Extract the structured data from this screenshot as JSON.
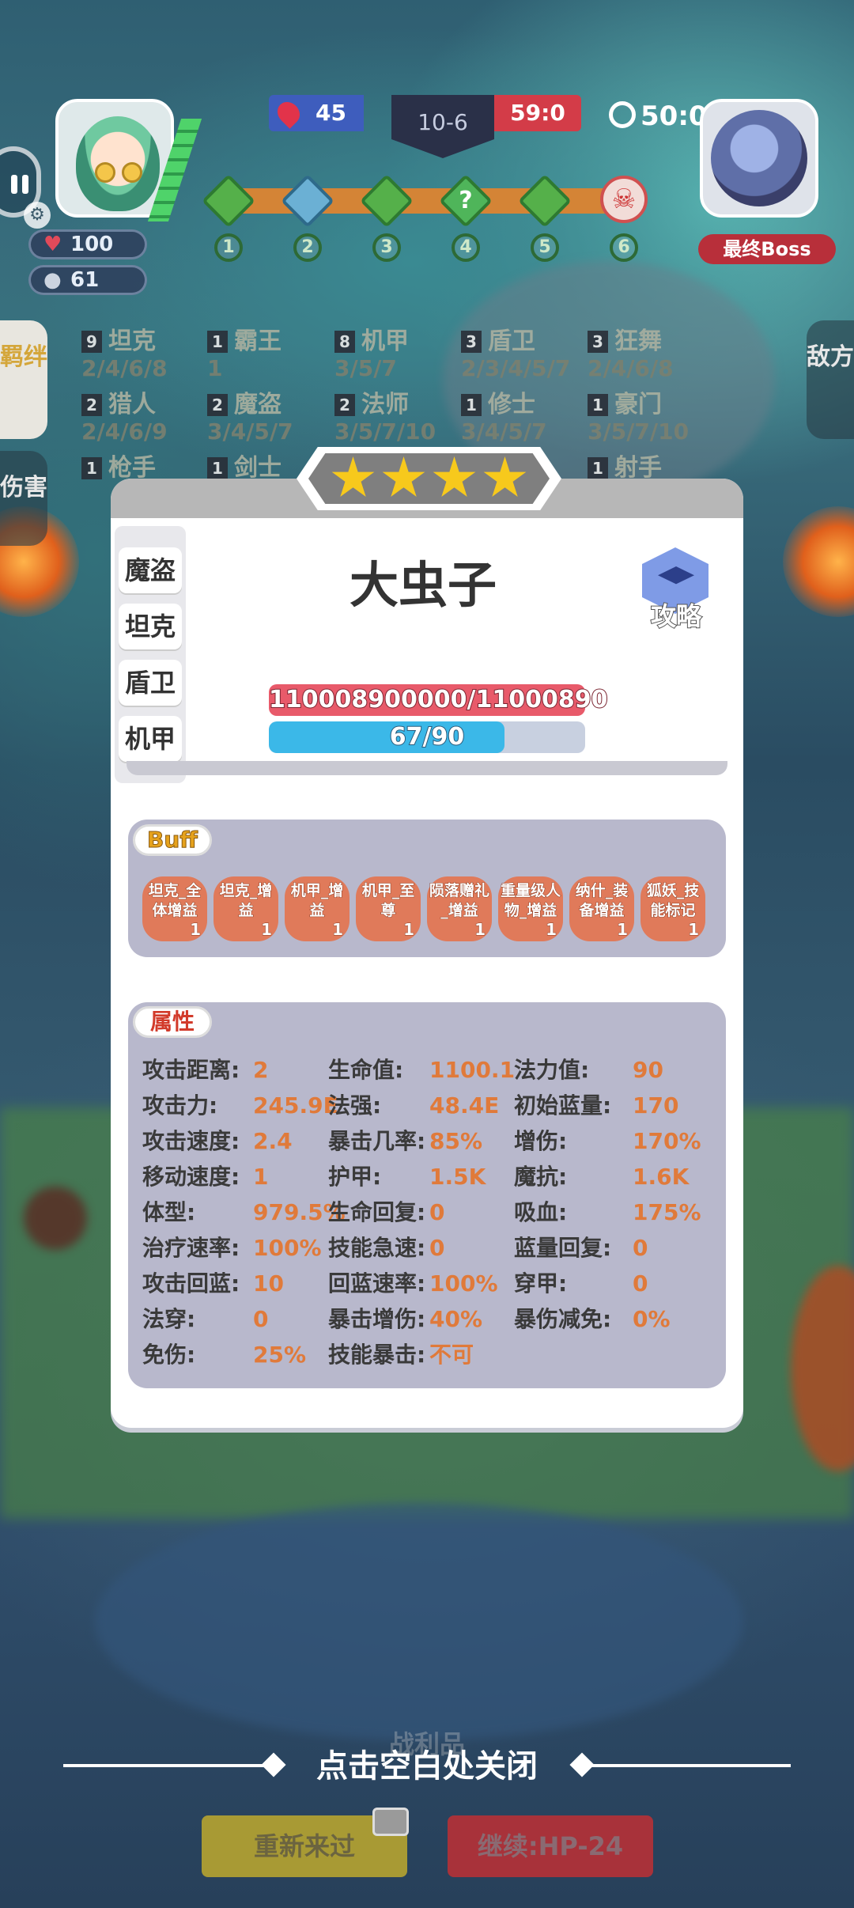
{
  "hud": {
    "player_hp": "100",
    "player_gold": "61",
    "score_left": "45",
    "stage": "10-6",
    "score_right": "59:0",
    "timer": "50:0",
    "boss_label": "最终Boss"
  },
  "stages": [
    "1",
    "2",
    "3",
    "4",
    "5",
    "6"
  ],
  "synergies": [
    {
      "count": "9",
      "name": "坦克",
      "levels": "2/4/6/8"
    },
    {
      "count": "1",
      "name": "霸王",
      "levels": "1"
    },
    {
      "count": "8",
      "name": "机甲",
      "levels": "3/5/7"
    },
    {
      "count": "3",
      "name": "盾卫",
      "levels": "2/3/4/5/7"
    },
    {
      "count": "3",
      "name": "狂舞",
      "levels": "2/4/6/8"
    },
    {
      "count": "2",
      "name": "猎人",
      "levels": "2/4/6/9"
    },
    {
      "count": "2",
      "name": "魔盗",
      "levels": "3/4/5/7"
    },
    {
      "count": "2",
      "name": "法师",
      "levels": "3/5/7/10"
    },
    {
      "count": "1",
      "name": "修士",
      "levels": "3/4/5/7"
    },
    {
      "count": "1",
      "name": "豪门",
      "levels": "3/5/7/10"
    },
    {
      "count": "1",
      "name": "枪手",
      "levels": ""
    },
    {
      "count": "1",
      "name": "剑士",
      "levels": ""
    },
    {
      "count": "1",
      "name": "射手",
      "levels": ""
    }
  ],
  "side_tabs": {
    "bond": "羁绊",
    "damage": "伤害",
    "enemy": "敌方"
  },
  "hero": {
    "stars": 4,
    "name": "大虫子",
    "guide_label": "攻略",
    "tags": [
      "魔盗",
      "坦克",
      "盾卫",
      "机甲"
    ],
    "hp_text": "110008900000/11000890",
    "mana_text": "67/90",
    "mana_fraction": 0.744
  },
  "buff_panel": {
    "title": "Buff",
    "buffs": [
      {
        "line1": "坦克_全",
        "line2": "体增益",
        "count": "1"
      },
      {
        "line1": "坦克_增",
        "line2": "益",
        "count": "1"
      },
      {
        "line1": "机甲_增",
        "line2": "益",
        "count": "1"
      },
      {
        "line1": "机甲_至",
        "line2": "尊",
        "count": "1"
      },
      {
        "line1": "陨落赠礼",
        "line2": "_增益",
        "count": "1"
      },
      {
        "line1": "重量级人",
        "line2": "物_增益",
        "count": "1"
      },
      {
        "line1": "纳什_装",
        "line2": "备增益",
        "count": "1"
      },
      {
        "line1": "狐妖_技",
        "line2": "能标记",
        "count": "1"
      }
    ]
  },
  "attr_panel": {
    "title": "属性",
    "rows": [
      [
        {
          "k": "攻击距离:",
          "v": "2"
        },
        {
          "k": "生命值:",
          "v": "1100.1"
        },
        {
          "k": "法力值:",
          "v": "90"
        }
      ],
      [
        {
          "k": "攻击力:",
          "v": "245.9E"
        },
        {
          "k": "法强:",
          "v": "48.4E"
        },
        {
          "k": "初始蓝量:",
          "v": "170"
        }
      ],
      [
        {
          "k": "攻击速度:",
          "v": "2.4"
        },
        {
          "k": "暴击几率:",
          "v": "85%"
        },
        {
          "k": "增伤:",
          "v": "170%"
        }
      ],
      [
        {
          "k": "移动速度:",
          "v": "1"
        },
        {
          "k": "护甲:",
          "v": "1.5K"
        },
        {
          "k": "魔抗:",
          "v": "1.6K"
        }
      ],
      [
        {
          "k": "体型:",
          "v": "979.5%"
        },
        {
          "k": "生命回复:",
          "v": "0"
        },
        {
          "k": "吸血:",
          "v": "175%"
        }
      ],
      [
        {
          "k": "治疗速率:",
          "v": "100%"
        },
        {
          "k": "技能急速:",
          "v": "0"
        },
        {
          "k": "蓝量回复:",
          "v": "0"
        }
      ],
      [
        {
          "k": "攻击回蓝:",
          "v": "10"
        },
        {
          "k": "回蓝速率:",
          "v": "100%"
        },
        {
          "k": "穿甲:",
          "v": "0"
        }
      ],
      [
        {
          "k": "法穿:",
          "v": "0"
        },
        {
          "k": "暴击增伤:",
          "v": "40%"
        },
        {
          "k": "暴伤减免:",
          "v": "0%"
        }
      ],
      [
        {
          "k": "免伤:",
          "v": "25%"
        },
        {
          "k": "技能暴击:",
          "v": "不可"
        }
      ]
    ]
  },
  "footer": {
    "close_hint": "点击空白处关闭",
    "spoils": "战利品",
    "retry_label": "重新来过",
    "continue_label": "继续:HP-24"
  },
  "colors": {
    "accent_orange": "#e07a3a",
    "buff_tile": "#e07a5a",
    "hp_bar": "#e85a6a",
    "mana_bar": "#3bb8e8",
    "star": "#f7c91c"
  }
}
